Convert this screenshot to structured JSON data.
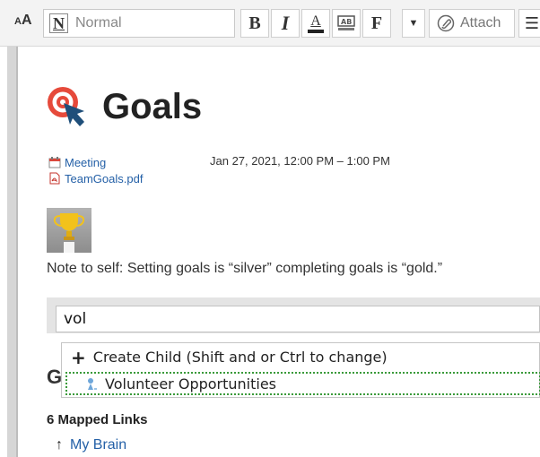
{
  "toolbar": {
    "style_value": "Normal",
    "attach_label": "Attach",
    "style_icon_letter": "N",
    "bold_glyph": "B",
    "italic_glyph": "I",
    "color_glyph": "A",
    "format_glyph": "F"
  },
  "page": {
    "title": "Goals",
    "event": {
      "label": "Meeting",
      "time": "Jan 27, 2021, 12:00 PM – 1:00 PM"
    },
    "attachment": "TeamGoals.pdf",
    "note": "Note to self:  Setting goals is “silver”  completing goals is “gold.”"
  },
  "search": {
    "value": "vol",
    "create_child_label": "Create Child (Shift and or Ctrl to change)",
    "result_label": "Volunteer Opportunities"
  },
  "sections": {
    "partial_heading": "G",
    "mapped_links": "6 Mapped Links",
    "first_link": "My Brain"
  },
  "colors": {
    "link": "#2460a7",
    "selection_border": "#3a9a3a",
    "title_icon_red": "#e64a3b",
    "title_icon_arrow": "#1f4f7a"
  },
  "icons": [
    "font-size-icon",
    "normal-style-icon",
    "bold-icon",
    "italic-icon",
    "font-color-icon",
    "highlight-icon",
    "format-icon",
    "dropdown-arrow-icon",
    "attach-icon",
    "list-icon",
    "goal-target-icon",
    "calendar-icon",
    "pdf-icon",
    "trophy-icon",
    "plus-icon",
    "thought-icon",
    "up-arrow-icon"
  ]
}
